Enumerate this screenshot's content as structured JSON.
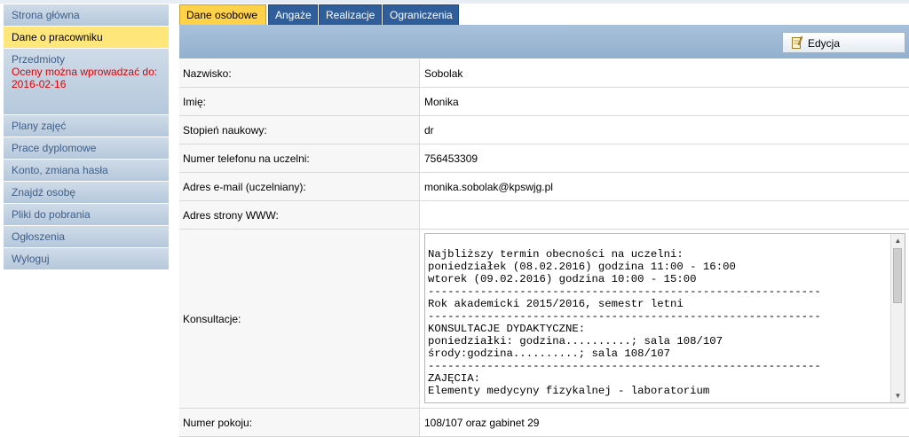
{
  "sidebar": {
    "items": [
      {
        "label": "Strona główna"
      },
      {
        "label": "Dane o pracowniku"
      },
      {
        "label": "Przedmioty",
        "warning": "Oceny można wprowadzać do: 2016-02-16"
      },
      {
        "label": "Plany zajęć"
      },
      {
        "label": "Prace dyplomowe"
      },
      {
        "label": "Konto, zmiana hasła"
      },
      {
        "label": "Znajdź osobę"
      },
      {
        "label": "Pliki do pobrania"
      },
      {
        "label": "Ogłoszenia"
      },
      {
        "label": "Wyloguj"
      }
    ]
  },
  "tabs": [
    {
      "label": "Dane osobowe"
    },
    {
      "label": "Angaże"
    },
    {
      "label": "Realizacje"
    },
    {
      "label": "Ograniczenia"
    }
  ],
  "toolbar": {
    "edit_label": "Edycja"
  },
  "fields": [
    {
      "label": "Nazwisko:",
      "value": "Sobolak"
    },
    {
      "label": "Imię:",
      "value": "Monika"
    },
    {
      "label": "Stopień naukowy:",
      "value": "dr"
    },
    {
      "label": "Numer telefonu na uczelni:",
      "value": "756453309"
    },
    {
      "label": "Adres e-mail (uczelniany):",
      "value": "monika.sobolak@kpswjg.pl"
    },
    {
      "label": "Adres strony WWW:",
      "value": ""
    }
  ],
  "consultations": {
    "label": "Konsultacje:",
    "text": "Najbliższy termin obecności na uczelni:\nponiedziałek (08.02.2016) godzina 11:00 - 16:00\nwtorek (09.02.2016) godzina 10:00 - 15:00\n------------------------------------------------------------\nRok akademicki 2015/2016, semestr letni\n------------------------------------------------------------\nKONSULTACJE DYDAKTYCZNE:\nponiedziałki: godzina..........; sala 108/107\nśrody:godzina..........; sala 108/107\n------------------------------------------------------------\nZAJĘCIA:\nElementy medycyny fizykalnej - laboratorium"
  },
  "room": {
    "label": "Numer pokoju:",
    "value": "108/107 oraz gabinet 29"
  },
  "colors": {
    "active_tab": "#ffd24a",
    "tab": "#2f5e9a",
    "active_nav": "#ffe67a",
    "warning": "#e00000"
  }
}
